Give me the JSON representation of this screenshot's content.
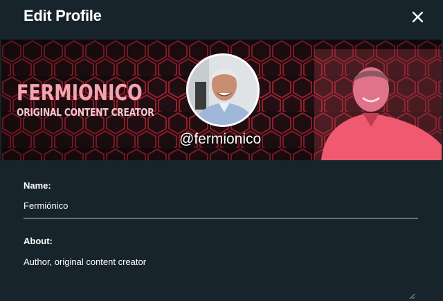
{
  "header": {
    "title": "Edit Profile"
  },
  "banner": {
    "brand_name": "FERMIONICO",
    "brand_subtitle": "ORIGINAL CONTENT CREATOR",
    "handle": "@fermionico"
  },
  "form": {
    "name_label": "Name:",
    "name_value": "Fermiónico",
    "about_label": "About:",
    "about_value": "Author, original content creator"
  },
  "colors": {
    "background": "#18242b",
    "accent": "#e23a4e"
  },
  "icons": {
    "close": "close-icon"
  }
}
